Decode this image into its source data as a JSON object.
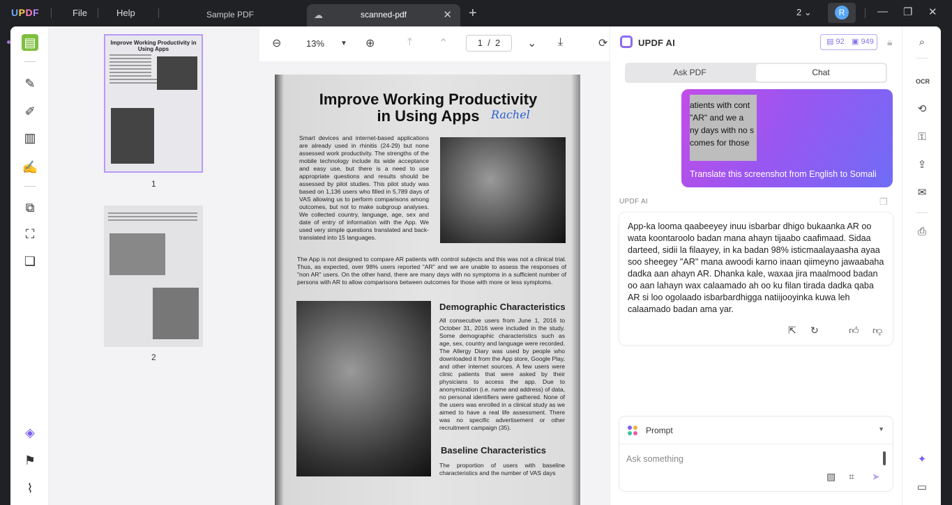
{
  "titlebar": {
    "logo": "UPDF",
    "menu_file": "File",
    "menu_help": "Help",
    "tab_inactive": "Sample PDF",
    "tab_active": "scanned-pdf",
    "window_count": "2",
    "avatar_initial": "R"
  },
  "thumbs": {
    "page1_label": "1",
    "page2_label": "2",
    "thumb1_title": "Improve Working Productivity in Using Apps"
  },
  "doc": {
    "zoom": "13%",
    "page_current": "1",
    "page_sep": "/",
    "page_total": "2",
    "title_line1": "Improve Working Productivity",
    "title_line2": "in Using Apps",
    "signature": "Rachel",
    "para1": "Smart devices and internet-based applications are already used in rhinitis (24-29) but none assessed work productivity. The strengths of the mobile technology include its wide acceptance and easy use, but there is a need to use appropriate questions and results should be assessed by pilot studies. This pilot study was based on 1,136 users who filled in 5,789 days of VAS allowing us to perform comparisons among outcomes, but not to make subgroup analyses. We collected country, language, age, sex and date of entry of information with the App. We used very simple questions translated and back-translated into 15 languages.",
    "para2": "The App is not designed to compare AR patients with control subjects and this was not a clinical trial. Thus, as expected, over 98% users reported \"AR\" and we are unable to assess the responses of \"non AR\" users. On the other hand, there are many days with no symptoms in a sufficient number of persons with AR to allow comparisons between outcomes for those with more or less symptoms.",
    "heading1": "Demographic Characteristics",
    "para3": "All consecutive users from June 1, 2016 to October 31, 2016 were included in the study. Some demographic characteristics such as age, sex, country and language were recorded. The Allergy Diary was used by people who downloaded it from the App store, Google Play, and other internet sources. A few users were clinic patients that were asked by their physicians to access the app. Due to anonymization (i.e. name and address) of data, no personal identifiers were gathered. None of the users was enrolled in a clinical study as we aimed to have a real life assessment. There was no specific advertisement or other recruitment campaign (35).",
    "heading2": "Baseline Characteristics",
    "para4": "The proportion of users with baseline characteristics and the number of VAS days"
  },
  "ai": {
    "title": "UPDF AI",
    "credits_a": "92",
    "credits_b": "949",
    "tab_ask": "Ask PDF",
    "tab_chat": "Chat",
    "screenshot_lines": [
      "atients with cont",
      "\"AR\" and we a",
      "ny days with no s",
      "comes for those"
    ],
    "user_message": "Translate this screenshot from English to Somali",
    "reply_label": "UPDF AI",
    "reply": "App-ka looma qaabeeyey inuu isbarbar dhigo bukaanka AR oo wata koontaroolo badan mana ahayn tijaabo caafimaad. Sidaa darteed, sidii la filaayey, in ka badan 98% isticmaalayaasha ayaa soo sheegey \"AR\" mana awoodi karno inaan qiimeyno jawaabaha dadka aan ahayn AR. Dhanka kale, waxaa jira maalmood badan oo aan lahayn wax calaamado ah oo ku filan tirada dadka qaba AR si loo ogolaado isbarbardhigga natiijooyinka kuwa leh calaamado badan ama yar.",
    "prompt_label": "Prompt",
    "input_placeholder": "Ask something"
  },
  "colors": {
    "accent": "#8a6bf0",
    "bubble_start": "#c24de8",
    "bubble_end": "#6f6cf6",
    "titlebar_bg": "#202124"
  }
}
